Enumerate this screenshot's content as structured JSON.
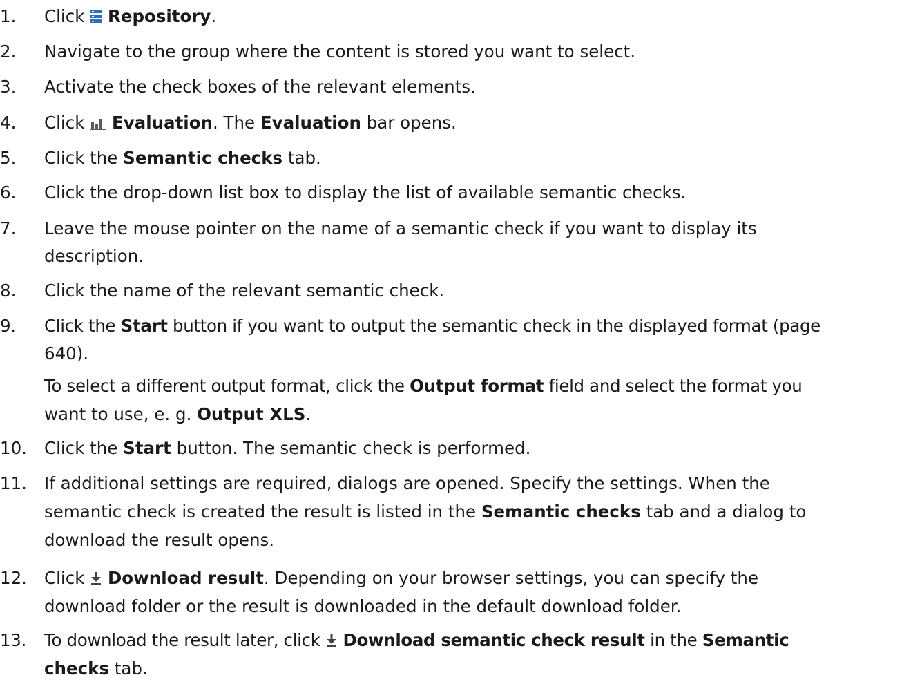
{
  "steps": [
    {
      "num": "1.",
      "pre": "Click ",
      "icon": "repository-icon",
      "b1": "Repository",
      "post": "."
    },
    {
      "num": "2.",
      "text": "Navigate to the group where the content is stored you want to select."
    },
    {
      "num": "3.",
      "text": "Activate the check boxes of the relevant elements."
    },
    {
      "num": "4.",
      "pre": "Click ",
      "icon": "evaluation-chart-icon",
      "b1": "Evaluation",
      "mid": ". The ",
      "b2": "Evaluation",
      "post": " bar opens."
    },
    {
      "num": "5.",
      "pre": "Click the ",
      "b1": "Semantic checks",
      "post": " tab."
    },
    {
      "num": "6.",
      "text": "Click the drop-down list box to display the list of available semantic checks."
    },
    {
      "num": "7.",
      "line1": "Leave the mouse pointer on the name of a semantic check if you want to display its",
      "line2": "description."
    },
    {
      "num": "8.",
      "text": "Click the name of the relevant semantic check."
    },
    {
      "num": "9.",
      "pre": "Click the ",
      "b1": "Start",
      "mid": " button if you want to output the semantic check in the displayed format (page",
      "line2": "640).",
      "line3_pre": "To select a different output format, click the ",
      "line3_b": "Output format",
      "line3_post": " field and select the format you",
      "line4_pre": "want to use, e. g. ",
      "line4_b": "Output XLS",
      "line4_post": "."
    },
    {
      "num": "10.",
      "pre": "Click the ",
      "b1": "Start",
      "post": " button. The semantic check is performed."
    },
    {
      "num": "11.",
      "line1": "If additional settings are required, dialogs are opened. Specify the settings. When the",
      "line2_pre": "semantic check is created the result is listed in the ",
      "line2_b": "Semantic checks",
      "line2_post": " tab and a dialog to",
      "line3": "download the result opens."
    },
    {
      "num": "12.",
      "pre": "Click ",
      "icon": "download-icon",
      "b1": "Download result",
      "post": ". Depending on your browser settings, you can specify the",
      "line2": "download folder or the result is downloaded in the default download folder."
    },
    {
      "num": "13.",
      "pre": "To download the result later, click ",
      "icon": "download-icon",
      "b1": "Download semantic check result",
      "mid": " in the ",
      "b2": "Semantic",
      "line2_b": "checks",
      "line2_post": " tab."
    }
  ],
  "colors": {
    "icon_blue": "#2f6fb3",
    "icon_gray": "#5a5a5a",
    "text": "#1a1a1a"
  }
}
